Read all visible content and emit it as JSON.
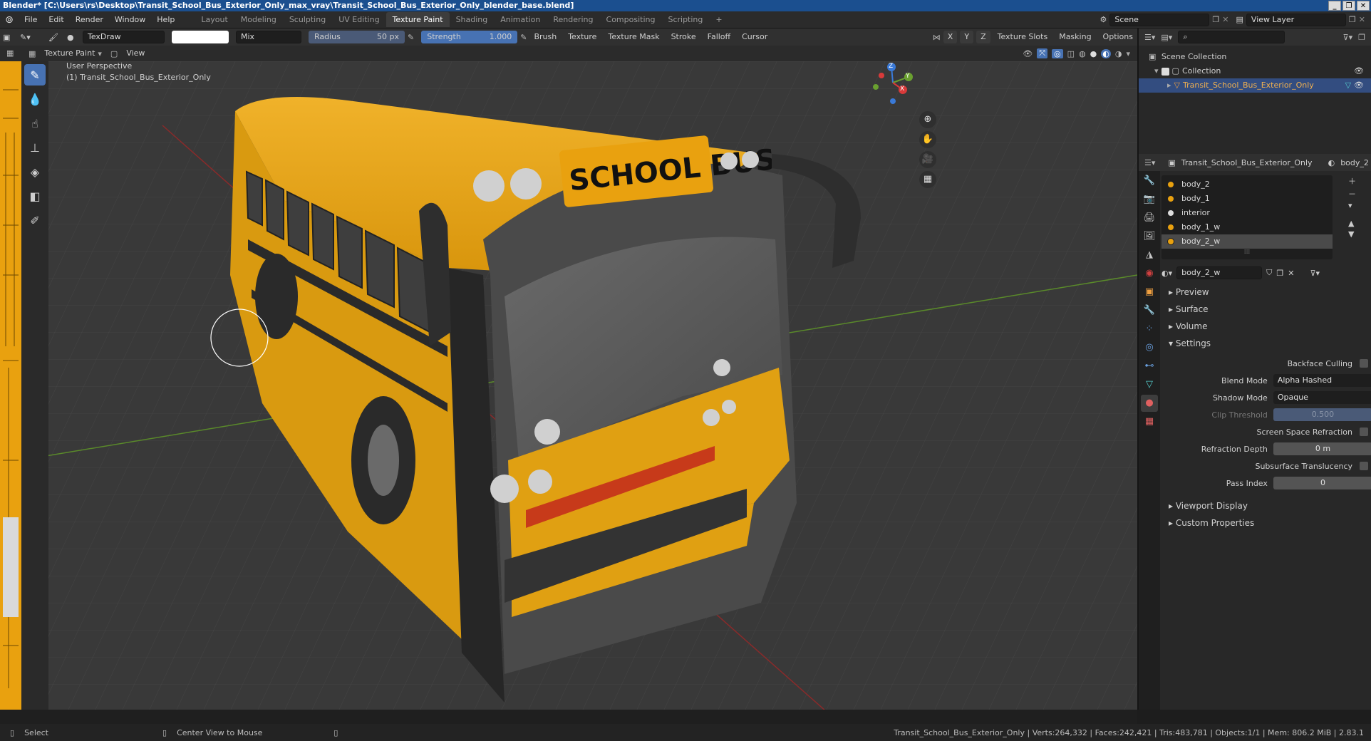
{
  "titlebar": {
    "text": "Blender* [C:\\Users\\rs\\Desktop\\Transit_School_Bus_Exterior_Only_max_vray\\Transit_School_Bus_Exterior_Only_blender_base.blend]"
  },
  "menubar": {
    "menus": [
      "File",
      "Edit",
      "Render",
      "Window",
      "Help"
    ],
    "workspaces": [
      "Layout",
      "Modeling",
      "Sculpting",
      "UV Editing",
      "Texture Paint",
      "Shading",
      "Animation",
      "Rendering",
      "Compositing",
      "Scripting"
    ],
    "active_workspace": "Texture Paint",
    "add_tab": "+",
    "scene": "Scene",
    "view_layer": "View Layer"
  },
  "toolheader": {
    "brush_name": "TexDraw",
    "blend": "Mix",
    "radius_label": "Radius",
    "radius_value": "50 px",
    "strength_label": "Strength",
    "strength_value": "1.000",
    "menus": [
      "Brush",
      "Texture",
      "Texture Mask",
      "Stroke",
      "Falloff",
      "Cursor"
    ],
    "axes": [
      "X",
      "Y",
      "Z"
    ],
    "right_menus": [
      "Texture Slots",
      "Masking",
      "Options"
    ]
  },
  "viewheader": {
    "mode": "Texture Paint",
    "view": "View"
  },
  "viewport": {
    "perspective": "User Perspective",
    "object_label": "(1) Transit_School_Bus_Exterior_Only",
    "bus_sign": "SCHOOL BUS",
    "gizmo_axes": [
      "Z",
      "Y",
      "X"
    ]
  },
  "outliner": {
    "scene_collection": "Scene Collection",
    "collection": "Collection",
    "object": "Transit_School_Bus_Exterior_Only"
  },
  "properties": {
    "object_name": "Transit_School_Bus_Exterior_Only",
    "material_short": "body_2",
    "slots": [
      "body_2",
      "body_1",
      "interior",
      "body_1_w",
      "body_2_w"
    ],
    "active_slot": "body_2_w",
    "material_name": "body_2_w",
    "panels": [
      "Preview",
      "Surface",
      "Volume",
      "Settings"
    ],
    "settings": {
      "backface_culling": "Backface Culling",
      "blend_mode_label": "Blend Mode",
      "blend_mode": "Alpha Hashed",
      "shadow_mode_label": "Shadow Mode",
      "shadow_mode": "Opaque",
      "clip_threshold_label": "Clip Threshold",
      "clip_threshold": "0.500",
      "ssr": "Screen Space Refraction",
      "refraction_depth_label": "Refraction Depth",
      "refraction_depth": "0 m",
      "subsurface": "Subsurface Translucency",
      "pass_index_label": "Pass Index",
      "pass_index": "0"
    },
    "bottom_panels": [
      "Viewport Display",
      "Custom Properties"
    ]
  },
  "statusbar": {
    "left1": "Select",
    "left2": "Center View to Mouse",
    "right": "Transit_School_Bus_Exterior_Only | Verts:264,332 | Faces:242,421 | Tris:483,781 | Objects:1/1 | Mem: 806.2 MiB | 2.83.1"
  },
  "colors": {
    "accent": "#4772b3",
    "bus_yellow": "#e9a10f",
    "background": "#393939"
  }
}
